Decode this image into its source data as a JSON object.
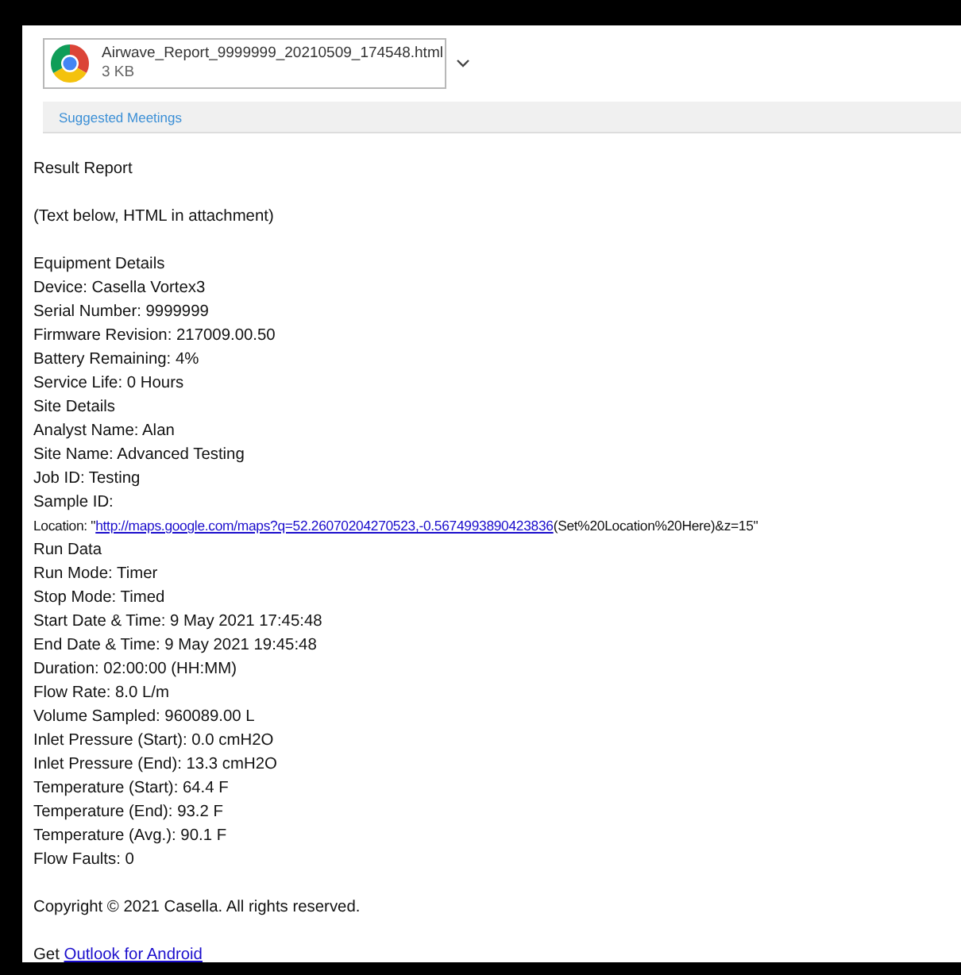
{
  "attachment": {
    "name": "Airwave_Report_9999999_20210509_174548.html",
    "size": "3 KB"
  },
  "suggested_meetings": "Suggested Meetings",
  "body": [
    {
      "kind": "text",
      "text": "Result Report",
      "gap": true
    },
    {
      "kind": "text",
      "text": "(Text below, HTML in attachment)",
      "gap": true
    },
    {
      "kind": "text",
      "text": "Equipment Details"
    },
    {
      "kind": "text",
      "text": "Device: Casella Vortex3"
    },
    {
      "kind": "text",
      "text": "Serial Number: 9999999"
    },
    {
      "kind": "text",
      "text": "Firmware Revision: 217009.00.50"
    },
    {
      "kind": "text",
      "text": "Battery Remaining: 4%"
    },
    {
      "kind": "text",
      "text": "Service Life: 0 Hours"
    },
    {
      "kind": "text",
      "text": "Site Details"
    },
    {
      "kind": "text",
      "text": "Analyst Name: Alan"
    },
    {
      "kind": "text",
      "text": "Site Name: Advanced Testing"
    },
    {
      "kind": "text",
      "text": "Job ID: Testing"
    },
    {
      "kind": "text",
      "text": "Sample ID:"
    },
    {
      "kind": "link",
      "before": "Location: \"",
      "link": "http://maps.google.com/maps?q=52.26070204270523,-0.5674993890423836",
      "after": "(Set%20Location%20Here)&z=15\""
    },
    {
      "kind": "text",
      "text": "Run Data"
    },
    {
      "kind": "text",
      "text": "Run Mode: Timer"
    },
    {
      "kind": "text",
      "text": "Stop Mode: Timed"
    },
    {
      "kind": "text",
      "text": "Start Date & Time: 9 May 2021 17:45:48"
    },
    {
      "kind": "text",
      "text": "End Date & Time: 9 May 2021 19:45:48"
    },
    {
      "kind": "text",
      "text": "Duration: 02:00:00 (HH:MM)"
    },
    {
      "kind": "text",
      "text": "Flow Rate: 8.0 L/m"
    },
    {
      "kind": "text",
      "text": "Volume Sampled: 960089.00 L"
    },
    {
      "kind": "text",
      "text": "Inlet Pressure (Start): 0.0 cmH2O"
    },
    {
      "kind": "text",
      "text": "Inlet Pressure (End): 13.3 cmH2O"
    },
    {
      "kind": "text",
      "text": "Temperature (Start): 64.4 F"
    },
    {
      "kind": "text",
      "text": "Temperature (End): 93.2 F"
    },
    {
      "kind": "text",
      "text": "Temperature (Avg.): 90.1 F"
    },
    {
      "kind": "text",
      "text": "Flow Faults: 0",
      "gap": true
    },
    {
      "kind": "text",
      "text": "Copyright © 2021 Casella. All rights reserved.",
      "gap": true
    },
    {
      "kind": "link",
      "before": "Get ",
      "link": "Outlook for Android"
    }
  ]
}
